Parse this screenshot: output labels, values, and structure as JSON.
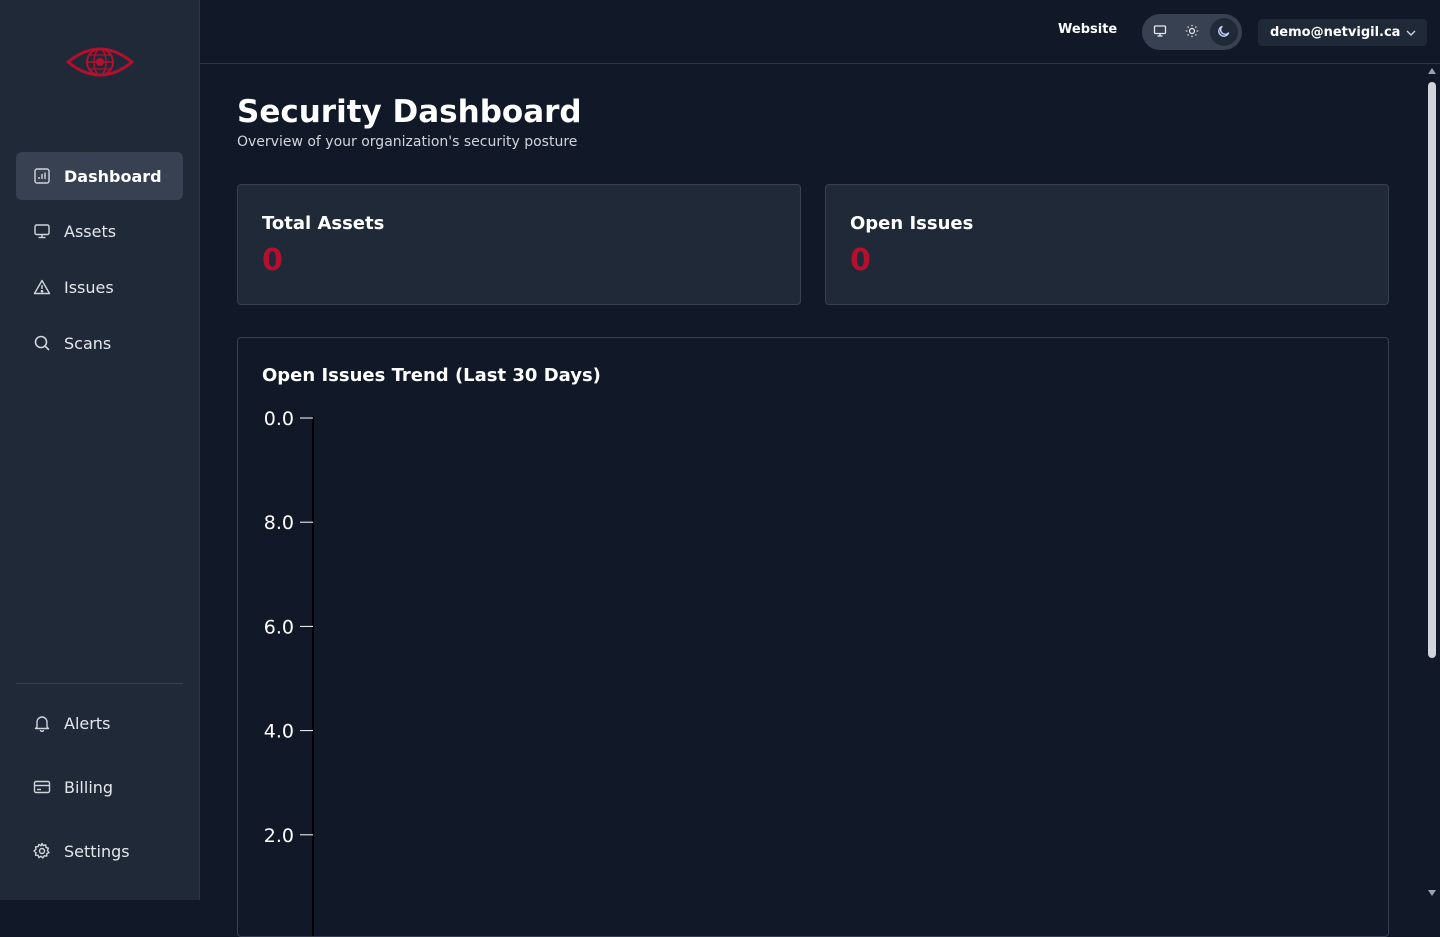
{
  "colors": {
    "background": "#111827",
    "sidebar": "#1f2937",
    "accent": "#b3102e",
    "card": "#1f2937",
    "active_nav": "#374151"
  },
  "sidebar": {
    "logo_icon": "eye-globe-logo",
    "nav_items": [
      {
        "label": "Dashboard",
        "icon": "bar-chart-icon",
        "active": true
      },
      {
        "label": "Assets",
        "icon": "monitor-icon"
      },
      {
        "label": "Issues",
        "icon": "warning-triangle-icon"
      },
      {
        "label": "Scans",
        "icon": "search-icon"
      }
    ],
    "bottom_items": [
      {
        "label": "Alerts",
        "icon": "bell-icon"
      },
      {
        "label": "Billing",
        "icon": "credit-card-icon"
      },
      {
        "label": "Settings",
        "icon": "gear-icon"
      }
    ]
  },
  "header": {
    "website_label": "Website",
    "theme_options": [
      "monitor-icon",
      "sun-icon",
      "moon-icon"
    ],
    "theme_selected": "moon-icon",
    "user_email": "demo@netvigil.ca"
  },
  "main": {
    "title": "Security Dashboard",
    "subtitle": "Overview of your organization's security posture",
    "cards": [
      {
        "title": "Total Assets",
        "value": "0"
      },
      {
        "title": "Open Issues",
        "value": "0"
      }
    ]
  },
  "chart_data": {
    "type": "line",
    "title": "Open Issues Trend (Last 30 Days)",
    "xlabel": "",
    "ylabel": "",
    "y_tick_labels": [
      "0.0",
      "8.0",
      "6.0",
      "4.0",
      "2.0"
    ],
    "x": [],
    "series": [
      {
        "values": []
      }
    ],
    "grid": false
  }
}
